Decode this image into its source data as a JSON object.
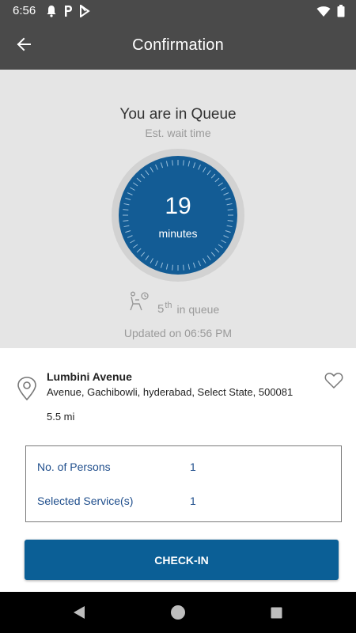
{
  "status_bar": {
    "time": "6:56",
    "left_icons": [
      "bell-icon",
      "parking-icon",
      "play-store-icon"
    ],
    "right_icons": [
      "wifi-icon",
      "battery-icon"
    ]
  },
  "app_bar": {
    "title": "Confirmation",
    "back_icon": "arrow-left-icon"
  },
  "queue": {
    "title": "You are in Queue",
    "wait_label": "Est. wait time",
    "wait_value": "19",
    "wait_unit": "minutes",
    "position_number": "5",
    "position_suffix": "th",
    "position_label": "in queue",
    "updated_text": "Updated on 06:56 PM"
  },
  "location": {
    "name": "Lumbini Avenue",
    "address": "Avenue, Gachibowli, hyderabad, Select State, 500081",
    "distance": "5.5 mi"
  },
  "details": {
    "persons_label": "No. of Persons",
    "persons_value": "1",
    "services_label": "Selected Service(s)",
    "services_value": "1"
  },
  "actions": {
    "checkin_label": "CHECK-IN"
  },
  "colors": {
    "app_bar": "#4a4a4a",
    "accent": "#0b5f96",
    "timer": "#135c95",
    "link_text": "#1f4e8c"
  }
}
